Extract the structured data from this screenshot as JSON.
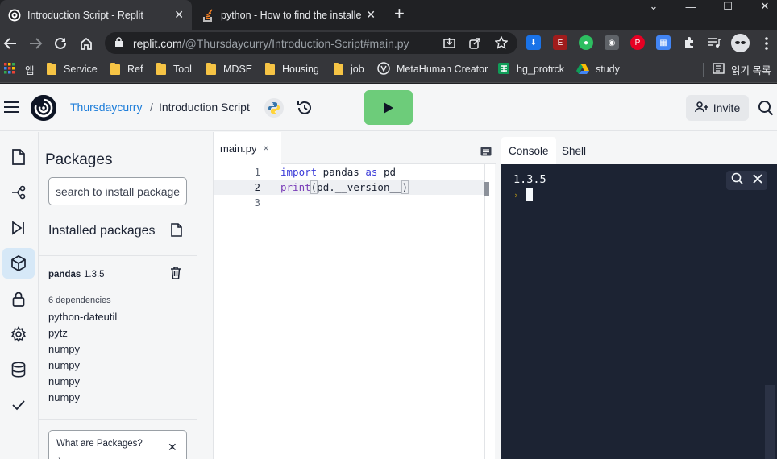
{
  "browser": {
    "tabs": [
      {
        "title": "Introduction Script - Replit",
        "active": true
      },
      {
        "title": "python - How to find the installe",
        "active": false
      }
    ],
    "new_tab": "+",
    "window_controls": {
      "minimize": "—",
      "maximize": "☐",
      "close": "✕",
      "tabsearch": "⌄"
    },
    "url_host": "replit.com",
    "url_path": "/@Thursdaycurry/Introduction-Script#main.py",
    "bookmarks": [
      {
        "label": "앱",
        "icon": "apps-grid-icon"
      },
      {
        "label": "Service",
        "icon": "folder-icon"
      },
      {
        "label": "Ref",
        "icon": "folder-icon"
      },
      {
        "label": "Tool",
        "icon": "folder-icon"
      },
      {
        "label": "MDSE",
        "icon": "folder-icon"
      },
      {
        "label": "Housing",
        "icon": "folder-icon"
      },
      {
        "label": "job",
        "icon": "folder-icon"
      },
      {
        "label": "MetaHuman Creator",
        "icon": "metahuman-icon"
      },
      {
        "label": "hg_protrck",
        "icon": "sheets-icon"
      },
      {
        "label": "study",
        "icon": "drive-icon"
      }
    ],
    "reading_list": "읽기 목록"
  },
  "header": {
    "owner": "Thursdaycurry",
    "separator": "/",
    "repl_name": "Introduction Script",
    "invite_label": "Invite"
  },
  "packages": {
    "title": "Packages",
    "search_placeholder": "search to install package",
    "installed_label": "Installed packages",
    "package_name": "pandas",
    "package_version": "1.3.5",
    "dependencies_label": "6 dependencies",
    "dependencies": [
      "python-dateutil",
      "pytz",
      "numpy",
      "numpy",
      "numpy",
      "numpy"
    ],
    "help_title": "What are Packages?",
    "help_chevron": "›",
    "help_close": "✕"
  },
  "editor": {
    "tab_label": "main.py",
    "tab_close": "×",
    "line_numbers": [
      "1",
      "2",
      "3"
    ],
    "line1": {
      "kw1": "import",
      "name": " pandas ",
      "kw2": "as",
      "alias": " pd"
    },
    "line2": {
      "fn": "print",
      "open": "(",
      "body": "pd.__version__",
      "close": ")"
    }
  },
  "right_panel": {
    "tabs": [
      "Console",
      "Shell"
    ],
    "console_output": "1.3.5",
    "prompt_symbol": "›"
  },
  "colors": {
    "run_green": "#6dcc7a",
    "link_blue": "#1b7cd9",
    "console_bg": "#1c2333",
    "active_nav": "#d6e8f7"
  }
}
